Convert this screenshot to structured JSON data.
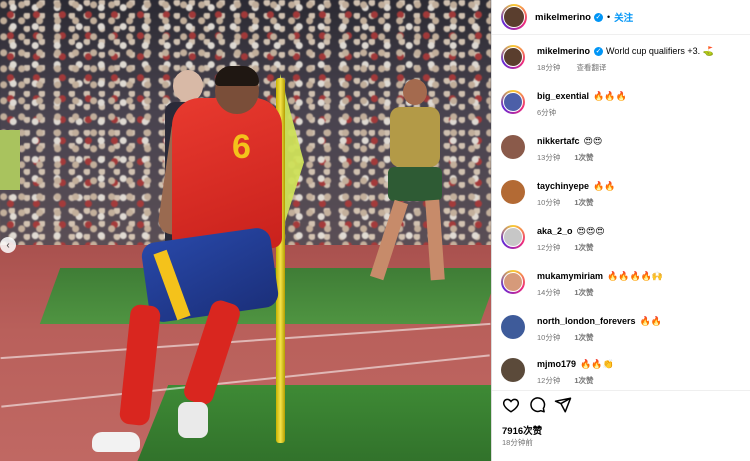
{
  "post": {
    "author": "mikelmerino",
    "follow_label": "关注",
    "separator": "•",
    "caption_text": "World cup qualifiers +3. ⛳",
    "caption_time": "18分钟",
    "translate_label": "查看翻译",
    "likes_total": "7916次赞",
    "posted_ago": "18分钟前"
  },
  "comments": [
    {
      "user": "big_exential",
      "text": "🔥🔥🔥",
      "time": "6分钟",
      "likes": "",
      "avatar_color": "#4c5fa8"
    },
    {
      "user": "nikkertafc",
      "text": "😍😍",
      "time": "13分钟",
      "likes": "1次赞",
      "avatar_color": "#8a5a4a"
    },
    {
      "user": "taychinyepe",
      "text": "🔥🔥",
      "time": "10分钟",
      "likes": "1次赞",
      "avatar_color": "#b36a34"
    },
    {
      "user": "aka_2_o",
      "text": "😍😍😍",
      "time": "12分钟",
      "likes": "1次赞",
      "avatar_color": "#c7c7c7"
    },
    {
      "user": "mukamymiriam",
      "text": "🔥🔥🔥🔥🙌",
      "time": "14分钟",
      "likes": "1次赞",
      "avatar_color": "#d69a7a"
    },
    {
      "user": "north_london_forevers",
      "text": "🔥🔥",
      "time": "10分钟",
      "likes": "1次赞",
      "avatar_color": "#3e5b9a"
    },
    {
      "user": "mjmo179",
      "text": "🔥🔥👏",
      "time": "12分钟",
      "likes": "1次赞",
      "avatar_color": "#5b4a3a"
    }
  ],
  "photo": {
    "jersey_number": "6",
    "nav_prev_icon": "‹"
  }
}
